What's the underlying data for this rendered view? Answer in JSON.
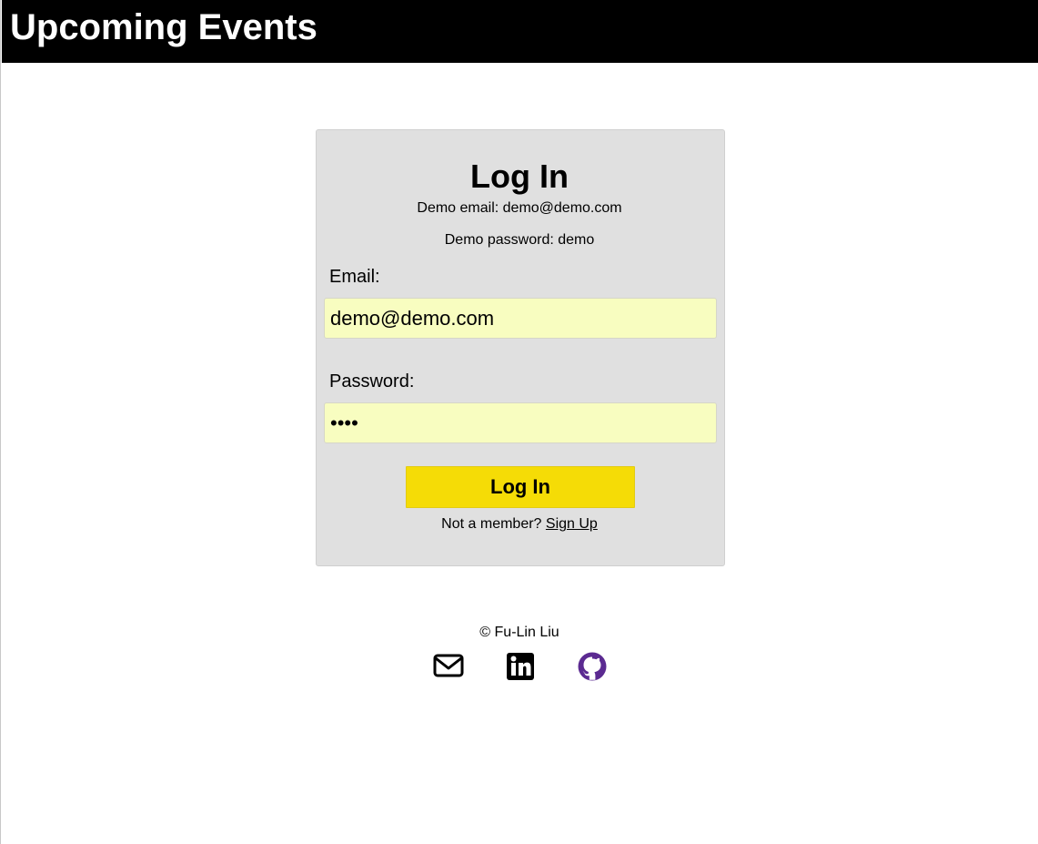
{
  "header": {
    "title": "Upcoming Events"
  },
  "login": {
    "title": "Log In",
    "demo_email_hint": "Demo email: demo@demo.com",
    "demo_password_hint": "Demo password: demo",
    "email_label": "Email:",
    "email_value": "demo@demo.com",
    "password_label": "Password:",
    "password_value": "demo",
    "submit_label": "Log In",
    "not_member_text": "Not a member?",
    "signup_link": "Sign Up"
  },
  "footer": {
    "copyright": "© Fu-Lin Liu",
    "icons": [
      "mail-icon",
      "linkedin-icon",
      "github-icon"
    ]
  },
  "colors": {
    "header_bg": "#000000",
    "card_bg": "#e0e0e0",
    "input_bg": "#f8fdc0",
    "button_bg": "#f5dc06",
    "github_purple": "#5b2a91"
  }
}
